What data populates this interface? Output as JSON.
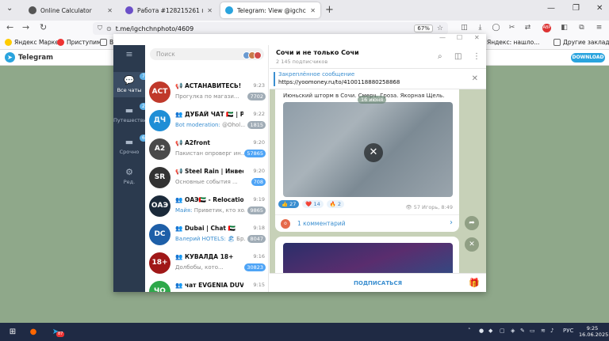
{
  "browser": {
    "tabs": [
      {
        "title": "Online Calculator",
        "active": false
      },
      {
        "title": "Работа #128215261 по заказу",
        "active": false
      },
      {
        "title": "Telegram: View @igchchnphoto",
        "active": true
      }
    ],
    "url": "t.me/igchchnphoto/4609",
    "zoom": "67%",
    "bookmarks": [
      {
        "label": "Яндекс Маркет"
      },
      {
        "label": "Приступим"
      },
      {
        "label": "Во"
      },
      {
        "label": "Яндекс: нашло..."
      },
      {
        "label": "Другие закладки"
      }
    ]
  },
  "telegram_web": {
    "title": "Telegram",
    "download_label": "DOWNLOAD"
  },
  "tg_app": {
    "rail": [
      {
        "label": "Все чаты",
        "badge": "728",
        "icon": "chat-bubbles-icon"
      },
      {
        "label": "Путешествия",
        "badge": "2",
        "icon": "folder-icon"
      },
      {
        "label": "Срочно",
        "badge": "6",
        "icon": "folder-icon"
      },
      {
        "label": "Ред.",
        "badge": "",
        "icon": "sliders-icon"
      }
    ],
    "search_placeholder": "Поиск",
    "chats": [
      {
        "name": "📢 АСТАНАВИТЕСЬ!",
        "time": "9:23",
        "preview": "Прогулка по магази...",
        "sender": "",
        "badge": "7702",
        "badge_blue": false,
        "avatar_text": "АСТ",
        "avatar_color": "#c0392b"
      },
      {
        "name": "👥 ДУБАЙ ЧАТ 🇦🇪 | РУС...",
        "time": "9:22",
        "preview": "@Ohol...",
        "sender": "Bot moderation:",
        "badge": "1815",
        "badge_blue": false,
        "avatar_text": "ДЧ",
        "avatar_color": "#1f8ed6"
      },
      {
        "name": "📢 A2front",
        "time": "9:20",
        "preview": "Пакистан опроверг ин...",
        "sender": "",
        "badge": "57865",
        "badge_blue": true,
        "avatar_text": "A2",
        "avatar_color": "#4a4a4a"
      },
      {
        "name": "📢 Steel Rain | Инвестиц...",
        "time": "9:20",
        "preview": "Основные события ...",
        "sender": "",
        "badge": "708",
        "badge_blue": true,
        "avatar_text": "SR",
        "avatar_color": "#333"
      },
      {
        "name": "👥 ОАЭ🇦🇪 - Relocation чат",
        "time": "9:19",
        "preview": "Приветик, кто хо...",
        "sender": "Майя:",
        "badge": "9865",
        "badge_blue": false,
        "avatar_text": "ОАЭ",
        "avatar_color": "#1b2a3a"
      },
      {
        "name": "👥 Dubai | Chat 🇦🇪",
        "time": "9:18",
        "preview": "Бр...",
        "sender": "Валерий HOTELS: 🏖",
        "badge": "8047",
        "badge_blue": false,
        "avatar_text": "DC",
        "avatar_color": "#1e5fa8"
      },
      {
        "name": "👥 КУВАЛДА 18+",
        "time": "9:16",
        "preview": "Долбобы, кото...",
        "sender": "",
        "badge": "30823",
        "badge_blue": true,
        "avatar_text": "18+",
        "avatar_color": "#a01818"
      },
      {
        "name": "👥 чат EVGENIA DUVAKI...",
        "time": "9:15",
        "preview": "Вааау ,какая кра...",
        "sender": "Сымбат:",
        "badge": "258",
        "badge_blue": false,
        "avatar_text": "ЧО",
        "avatar_color": "#2ea84a"
      }
    ],
    "channel": {
      "title": "Сочи и не только Сочи",
      "subscribers": "2 145 подписчиков"
    },
    "pinned": {
      "title": "Закреплённое сообщение",
      "text": "https://yoomoney.ru/to/4100118880258868"
    },
    "message": {
      "text": "Июньский шторм в Сочи. Смерч. Гроза. Якорная Щель.",
      "date_tag": "16 июня",
      "reactions": [
        {
          "emoji": "👍",
          "count": "27",
          "selected": true
        },
        {
          "emoji": "❤️",
          "count": "14",
          "selected": false
        },
        {
          "emoji": "🔥",
          "count": "2",
          "selected": false
        }
      ],
      "views": "57",
      "author_time": "Игорь, 8:49",
      "comments_label": "1 комментарий"
    },
    "subscribe_label": "ПОДПИСАТЬСЯ"
  },
  "taskbar": {
    "lang": "РУС",
    "time": "9:25",
    "date": "16.06.2025",
    "tg_badge": "87"
  }
}
